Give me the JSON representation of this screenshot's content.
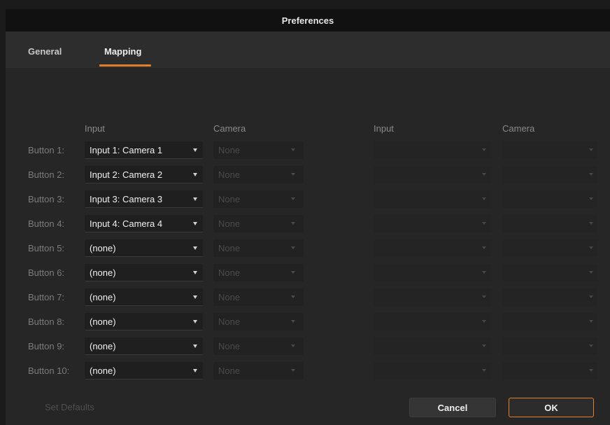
{
  "window": {
    "title": "Preferences"
  },
  "tabs": [
    {
      "label": "General",
      "active": false
    },
    {
      "label": "Mapping",
      "active": true
    }
  ],
  "headers": {
    "input1": "Input",
    "camera1": "Camera",
    "input2": "Input",
    "camera2": "Camera"
  },
  "rows": [
    {
      "label": "Button 1:",
      "input": "Input 1: Camera 1",
      "camera": "None"
    },
    {
      "label": "Button 2:",
      "input": "Input 2: Camera 2",
      "camera": "None"
    },
    {
      "label": "Button 3:",
      "input": "Input 3: Camera 3",
      "camera": "None"
    },
    {
      "label": "Button 4:",
      "input": "Input 4: Camera 4",
      "camera": "None"
    },
    {
      "label": "Button 5:",
      "input": "(none)",
      "camera": "None"
    },
    {
      "label": "Button 6:",
      "input": "(none)",
      "camera": "None"
    },
    {
      "label": "Button 7:",
      "input": "(none)",
      "camera": "None"
    },
    {
      "label": "Button 8:",
      "input": "(none)",
      "camera": "None"
    },
    {
      "label": "Button 9:",
      "input": "(none)",
      "camera": "None"
    },
    {
      "label": "Button 10:",
      "input": "(none)",
      "camera": "None"
    }
  ],
  "footer": {
    "set_defaults": "Set Defaults",
    "cancel": "Cancel",
    "ok": "OK"
  },
  "colors": {
    "accent": "#e07f2c",
    "background": "#262626",
    "titlebar": "#111111"
  }
}
